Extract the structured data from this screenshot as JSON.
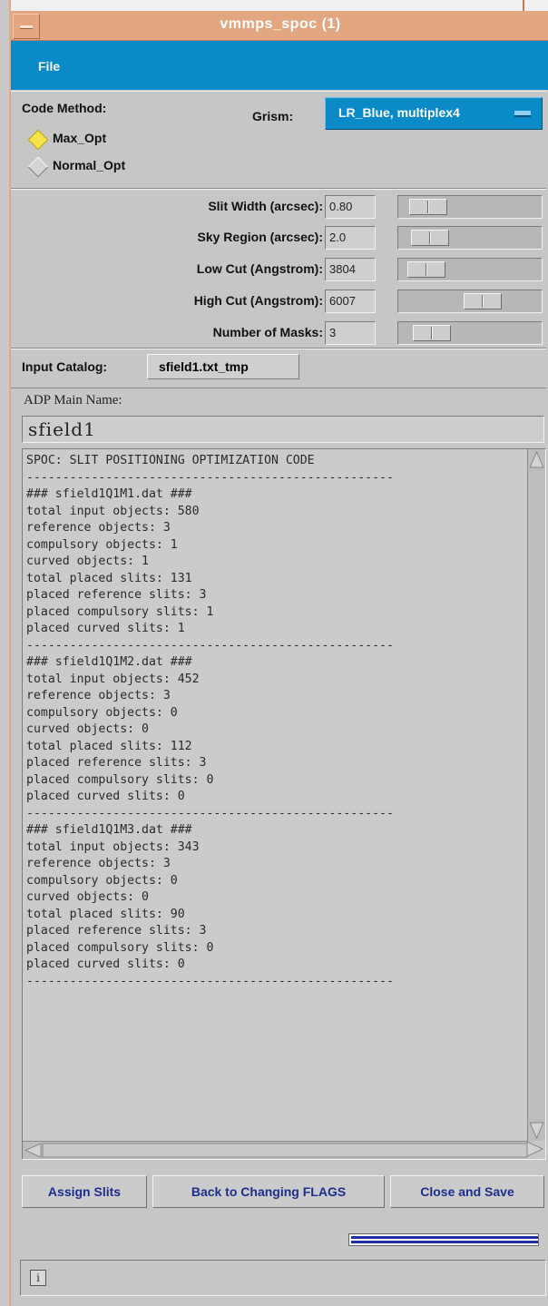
{
  "window": {
    "title": "vmmps_spoc (1)"
  },
  "menu": {
    "file": "File"
  },
  "code_method": {
    "label": "Code Method:",
    "options": [
      {
        "label": "Max_Opt",
        "selected": true
      },
      {
        "label": "Normal_Opt",
        "selected": false
      }
    ]
  },
  "grism": {
    "label": "Grism:",
    "value": "LR_Blue, multiplex4"
  },
  "params": [
    {
      "label": "Slit Width (arcsec):",
      "value": "0.80"
    },
    {
      "label": "Sky Region (arcsec):",
      "value": "2.0"
    },
    {
      "label": "Low Cut (Angstrom):",
      "value": "3804"
    },
    {
      "label": "High Cut (Angstrom):",
      "value": "6007"
    },
    {
      "label": "Number of Masks:",
      "value": "3"
    }
  ],
  "input_catalog": {
    "label": "Input Catalog:",
    "value": "sfield1.txt_tmp"
  },
  "adp": {
    "label": "ADP Main Name:",
    "value": "sfield1"
  },
  "output_text": "SPOC: SLIT POSITIONING OPTIMIZATION CODE\n---------------------------------------------------\n### sfield1Q1M1.dat ###\ntotal input objects: 580\nreference objects: 3\ncompulsory objects: 1\ncurved objects: 1\ntotal placed slits: 131\nplaced reference slits: 3\nplaced compulsory slits: 1\nplaced curved slits: 1\n---------------------------------------------------\n### sfield1Q1M2.dat ###\ntotal input objects: 452\nreference objects: 3\ncompulsory objects: 0\ncurved objects: 0\ntotal placed slits: 112\nplaced reference slits: 3\nplaced compulsory slits: 0\nplaced curved slits: 0\n---------------------------------------------------\n### sfield1Q1M3.dat ###\ntotal input objects: 343\nreference objects: 3\ncompulsory objects: 0\ncurved objects: 0\ntotal placed slits: 90\nplaced reference slits: 3\nplaced compulsory slits: 0\nplaced curved slits: 0\n---------------------------------------------------",
  "buttons": {
    "assign": "Assign Slits",
    "back": "Back to Changing FLAGS",
    "close": "Close and Save"
  },
  "status": {
    "icon": "i"
  },
  "colors": {
    "accent": "#0a8ac6",
    "title_bar": "#e2a780",
    "button_text": "#1c2d8c",
    "radio_on": "#f4e44a"
  },
  "icons": [
    "window-menu-icon",
    "option-menu-indicator-icon",
    "info-icon",
    "scroll-up-arrow-icon",
    "scroll-down-arrow-icon",
    "scroll-left-arrow-icon",
    "scroll-right-arrow-icon"
  ]
}
